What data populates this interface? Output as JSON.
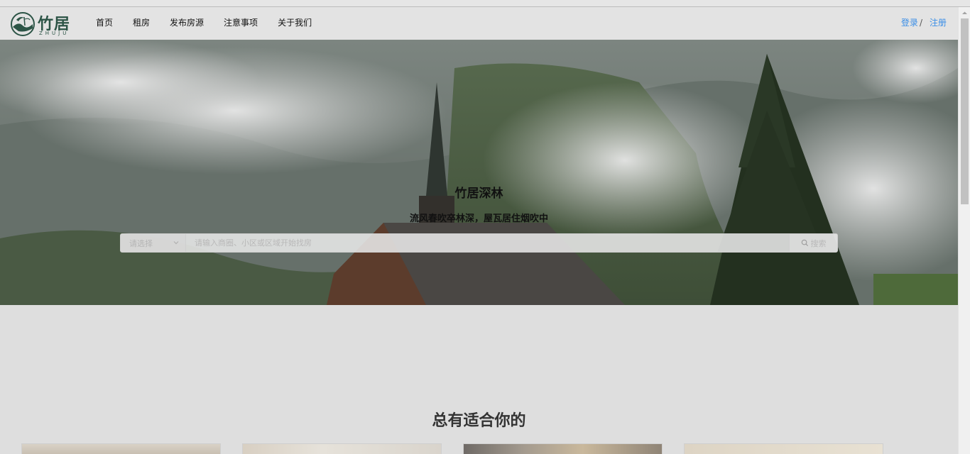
{
  "brand": {
    "name": "竹居",
    "sub": "ZHUJU"
  },
  "nav": {
    "items": [
      {
        "label": "首页"
      },
      {
        "label": "租房"
      },
      {
        "label": "发布房源"
      },
      {
        "label": "注意事项"
      },
      {
        "label": "关于我们"
      }
    ],
    "login": "登录",
    "separator": "/",
    "register": "注册"
  },
  "hero": {
    "title": "竹居深林",
    "subtitle": "流风春吹卒林深，屋瓦居住烟吹中"
  },
  "search": {
    "select_placeholder": "请选择",
    "input_placeholder": "请输入商圈、小区或区域开始找房",
    "button_label": "搜索"
  },
  "section": {
    "title": "总有适合你的"
  },
  "colors": {
    "brand_green": "#2c5446",
    "link_blue": "#3a8ee6",
    "page_bg": "#dedede"
  }
}
